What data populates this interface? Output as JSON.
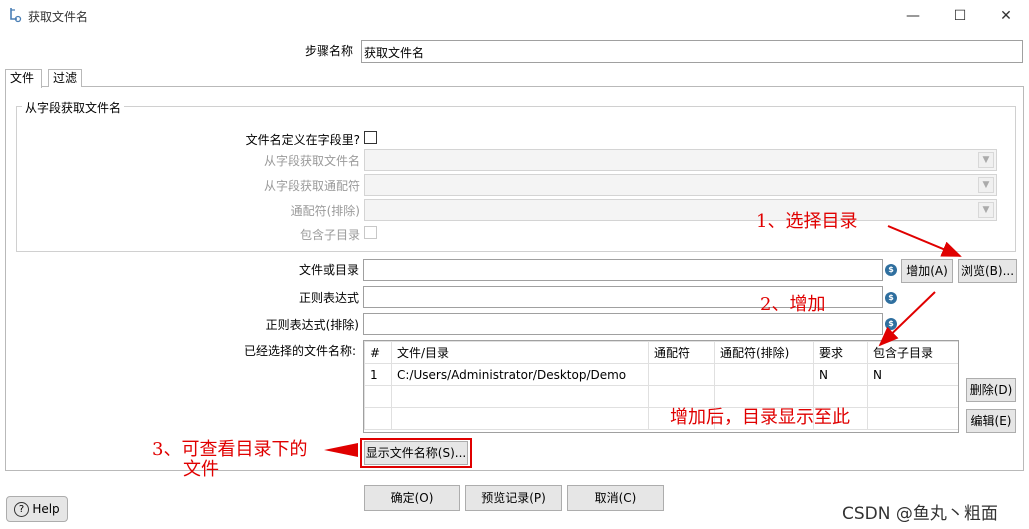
{
  "window": {
    "title": "获取文件名",
    "minimize_glyph": "—",
    "maximize_glyph": "☐",
    "close_glyph": "✕"
  },
  "step_name": {
    "label": "步骤名称",
    "value": "获取文件名"
  },
  "tabs": [
    {
      "label": "文件"
    },
    {
      "label": "过滤"
    }
  ],
  "from_field_group": {
    "legend": "从字段获取文件名",
    "filename_defined_in_field_label": "文件名定义在字段里?",
    "field_filename_label": "从字段获取文件名",
    "field_wildcard_label": "从字段获取通配符",
    "wildcard_exclude_label": "通配符(排除)",
    "include_subfolders_label": "包含子目录"
  },
  "file_inputs": {
    "file_or_dir_label": "文件或目录",
    "regex_label": "正则表达式",
    "regex_exclude_label": "正则表达式(排除)",
    "var_icon": "$",
    "add_button": "增加(A)",
    "browse_button": "浏览(B)..."
  },
  "selected_files": {
    "label": "已经选择的文件名称:",
    "columns": [
      "#",
      "文件/目录",
      "通配符",
      "通配符(排除)",
      "要求",
      "包含子目录"
    ],
    "rows": [
      {
        "num": "1",
        "path": "C:/Users/Administrator/Desktop/Demo",
        "wildcard": "",
        "wildcard_exclude": "",
        "required": "N",
        "include_subfolders": "N"
      }
    ],
    "delete_button": "删除(D)",
    "edit_button": "编辑(E)",
    "show_filenames_button": "显示文件名称(S)..."
  },
  "footer": {
    "help_button": "Help",
    "ok_button": "确定(O)",
    "preview_button": "预览记录(P)",
    "cancel_button": "取消(C)"
  },
  "annotations": {
    "step1": "1、选择目录",
    "step2": "2、增加",
    "after_add": "增加后，目录显示至此",
    "step3_line1": "3、可查看目录下的",
    "step3_line2": "文件"
  },
  "watermark": "CSDN @鱼丸丶粗面",
  "colors": {
    "annotation_red": "#e00000",
    "highlight_border": "#e00000"
  }
}
